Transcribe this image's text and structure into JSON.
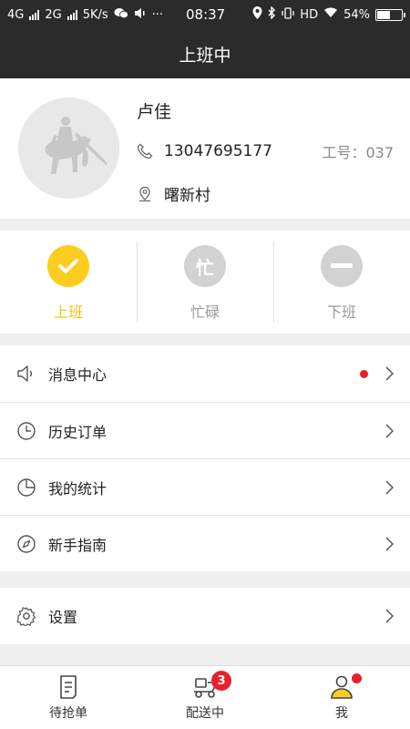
{
  "statusbar": {
    "net1": "4G",
    "net2": "2G",
    "speed": "5K/s",
    "dots": "···",
    "time": "08:37",
    "hd": "HD",
    "battery": "54%",
    "battery_level": 0.54
  },
  "navbar": {
    "title": "上班中"
  },
  "profile": {
    "name": "卢佳",
    "phone": "13047695177",
    "employee_no": "工号：037",
    "location": "曙新村"
  },
  "status_buttons": [
    {
      "label": "上班",
      "icon": "check-icon",
      "active": true
    },
    {
      "label": "忙碌",
      "icon_text": "忙",
      "active": false
    },
    {
      "label": "下班",
      "icon": "minus-icon",
      "active": false
    }
  ],
  "menu": {
    "items": [
      {
        "label": "消息中心",
        "icon": "speaker-icon",
        "has_dot": true
      },
      {
        "label": "历史订单",
        "icon": "clock-icon"
      },
      {
        "label": "我的统计",
        "icon": "pie-chart-icon"
      },
      {
        "label": "新手指南",
        "icon": "compass-icon"
      }
    ],
    "settings": {
      "label": "设置",
      "icon": "gear-icon"
    }
  },
  "tabbar": {
    "tabs": [
      {
        "label": "待抢单",
        "icon": "document-icon"
      },
      {
        "label": "配送中",
        "icon": "scooter-icon",
        "badge": "3"
      },
      {
        "label": "我",
        "icon": "user-icon",
        "has_dot": true
      }
    ]
  },
  "colors": {
    "accent": "#fccd1f",
    "dark": "#2b2b2b",
    "alert": "#e8202a"
  }
}
